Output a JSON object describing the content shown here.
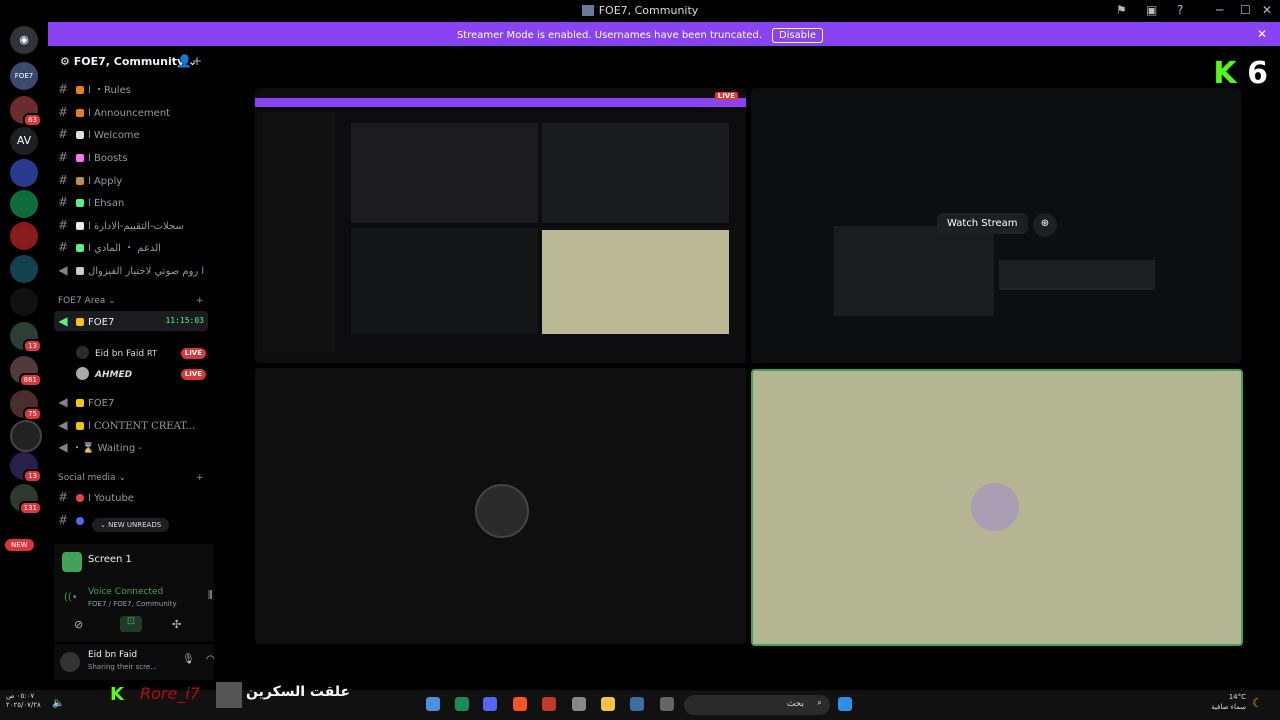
{
  "window": {
    "title": "FOE7, Community",
    "controls": [
      "─",
      "☐",
      "✕"
    ]
  },
  "banner": {
    "text": "Streamer Mode is enabled. Usernames have been truncated.",
    "button": "Disable"
  },
  "servers": {
    "top_label": "FOE7",
    "av_label": "AV",
    "badges": [
      "13",
      "861",
      "75",
      "13",
      "131"
    ],
    "new_pill": "NEW",
    "badge_63": "63"
  },
  "guild": {
    "name": "FOE7, Community"
  },
  "channels": [
    {
      "label": "ا ・Rules",
      "color": "#e67e22"
    },
    {
      "label": "ا Announcement",
      "color": "#e67e22"
    },
    {
      "label": "ا Welcome",
      "color": "#ddd"
    },
    {
      "label": "ا Boosts",
      "color": "#ff73fa"
    },
    {
      "label": "ا Apply",
      "color": "#c68a4b"
    },
    {
      "label": "ا Ehsan",
      "color": "#57f287"
    },
    {
      "label": "سجلات-التقييم-الادارة ا",
      "color": "#eee"
    },
    {
      "label": "الدعم ・ المادي ا",
      "color": "#57f287"
    },
    {
      "label": "ا روم صوتي لاختيار الفيزوال",
      "color": "#ccc"
    }
  ],
  "categories": {
    "area": "FOE7 Area",
    "social": "Social media"
  },
  "voice": {
    "channel": "FOE7",
    "timer": "11:15:03",
    "users": [
      {
        "name": "Eid bn Faid",
        "tag": "RT",
        "live": "LIVE"
      },
      {
        "name": "AHMED",
        "live": "LIVE"
      }
    ]
  },
  "more_channels": [
    {
      "label": "FOE7"
    },
    {
      "label": "ا CONTENT CREAT..."
    },
    {
      "label": "・⌛ Waiting -"
    }
  ],
  "social_channels": [
    {
      "label": "ا Youtube"
    }
  ],
  "new_unreads": "NEW UNREADS",
  "screen_panel": {
    "title": "Screen 1"
  },
  "voice_connected": {
    "status": "Voice Connected",
    "location": "FOE7 / FOE7, Community"
  },
  "user": {
    "name": "Eid bn Faid",
    "status": "Sharing their scre..."
  },
  "stream": {
    "watch_label": "Watch Stream",
    "live_label": "LIVE",
    "kick_6": "6"
  },
  "taskbar": {
    "search_placeholder": "بحث",
    "overlay_name": "Rore_i7",
    "overlay_caption": "علقت السكرين",
    "weather_temp": "14°C",
    "weather_desc": "سماء صافية",
    "time": "٠٥:٠٧ ص",
    "date": "٢٠٢٥/٠٧/٢٨"
  }
}
